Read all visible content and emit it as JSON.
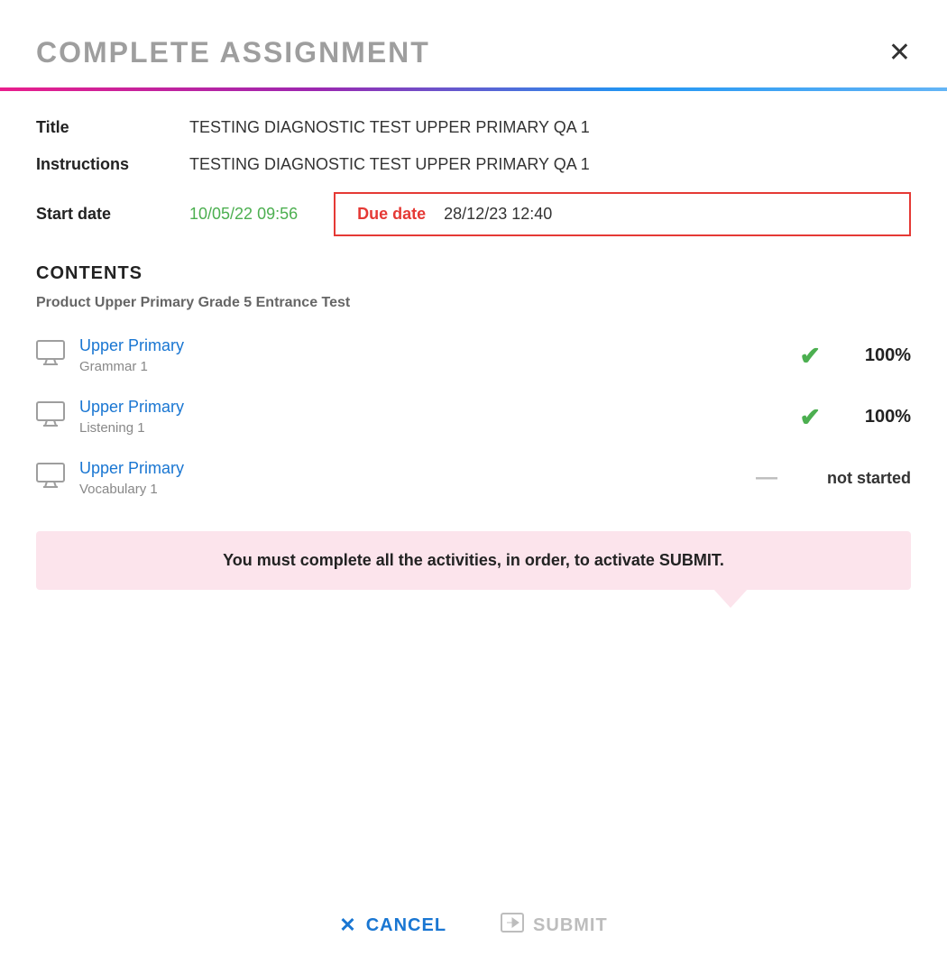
{
  "modal": {
    "title": "COMPLETE ASSIGNMENT",
    "close_label": "✕",
    "fields": {
      "title_label": "Title",
      "title_value": "TESTING DIAGNOSTIC TEST UPPER PRIMARY QA 1",
      "instructions_label": "Instructions",
      "instructions_value": "TESTING DIAGNOSTIC TEST UPPER PRIMARY QA 1",
      "start_date_label": "Start date",
      "start_date_value": "10/05/22 09:56",
      "due_date_label": "Due date",
      "due_date_value": "28/12/23 12:40"
    },
    "contents": {
      "heading": "CONTENTS",
      "product_label": "Product Upper Primary Grade 5 Entrance Test",
      "items": [
        {
          "title": "Upper Primary",
          "subtitle": "Grammar 1",
          "status": "completed",
          "percent": "100%"
        },
        {
          "title": "Upper Primary",
          "subtitle": "Listening 1",
          "status": "completed",
          "percent": "100%"
        },
        {
          "title": "Upper Primary",
          "subtitle": "Vocabulary 1",
          "status": "not_started",
          "percent": "not started"
        }
      ]
    },
    "warning": {
      "text": "You must complete all the activities, in order, to activate SUBMIT."
    },
    "footer": {
      "cancel_label": "CANCEL",
      "submit_label": "SUBMIT"
    }
  }
}
